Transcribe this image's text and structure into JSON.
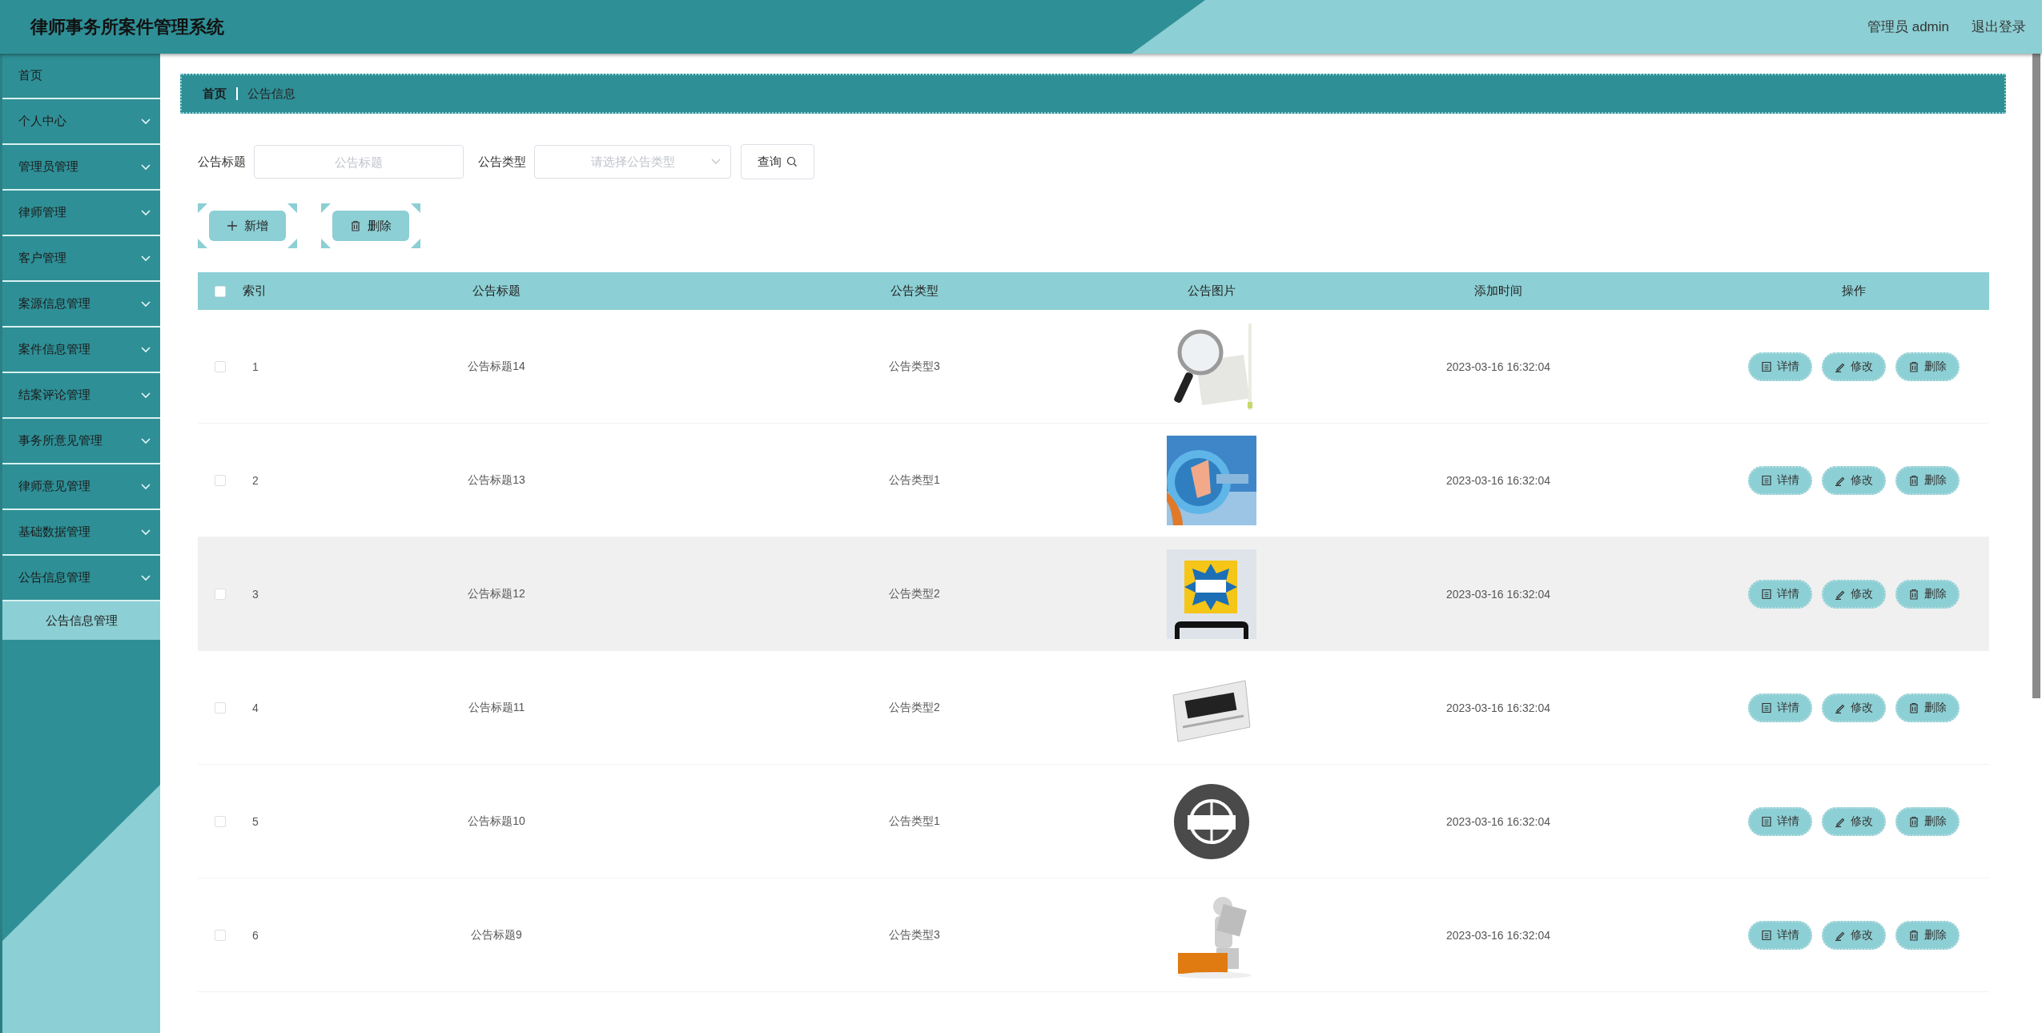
{
  "header": {
    "title": "律师事务所案件管理系统",
    "user": "管理员 admin",
    "logout": "退出登录"
  },
  "sidebar": {
    "items": [
      {
        "label": "首页",
        "kind": "link"
      },
      {
        "label": "个人中心",
        "kind": "menu"
      },
      {
        "label": "管理员管理",
        "kind": "menu"
      },
      {
        "label": "律师管理",
        "kind": "menu"
      },
      {
        "label": "客户管理",
        "kind": "menu"
      },
      {
        "label": "案源信息管理",
        "kind": "menu"
      },
      {
        "label": "案件信息管理",
        "kind": "menu"
      },
      {
        "label": "结案评论管理",
        "kind": "menu"
      },
      {
        "label": "事务所意见管理",
        "kind": "menu"
      },
      {
        "label": "律师意见管理",
        "kind": "menu"
      },
      {
        "label": "基础数据管理",
        "kind": "menu"
      },
      {
        "label": "公告信息管理",
        "kind": "menu",
        "children": [
          {
            "label": "公告信息管理",
            "selected": true
          }
        ]
      }
    ]
  },
  "breadcrumb": [
    "首页",
    "公告信息"
  ],
  "search": {
    "fields": [
      {
        "label": "公告标题",
        "kind": "input",
        "placeholder": "公告标题"
      },
      {
        "label": "公告类型",
        "kind": "select",
        "placeholder": "请选择公告类型"
      }
    ],
    "button": "查询"
  },
  "actions": [
    {
      "label": "新增",
      "kind": "add"
    },
    {
      "label": "删除",
      "kind": "delete"
    }
  ],
  "table": {
    "select_all": {
      "checked": false
    },
    "columns": [
      "索引",
      "公告标题",
      "公告类型",
      "公告图片",
      "添加时间",
      "操作"
    ],
    "rows": [
      {
        "index": "1",
        "title": "公告标题14",
        "type": "公告类型3",
        "time": "2023-03-16 16:32:04",
        "checked": false,
        "hovered": false,
        "buttons": [
          {
            "label": "详情",
            "kind": "detail"
          },
          {
            "label": "修改",
            "kind": "edit"
          },
          {
            "label": "删除",
            "kind": "delete"
          }
        ]
      },
      {
        "index": "2",
        "title": "公告标题13",
        "type": "公告类型1",
        "time": "2023-03-16 16:32:04",
        "checked": false,
        "hovered": false,
        "buttons": [
          {
            "label": "详情",
            "kind": "detail"
          },
          {
            "label": "修改",
            "kind": "edit"
          },
          {
            "label": "删除",
            "kind": "delete"
          }
        ]
      },
      {
        "index": "3",
        "title": "公告标题12",
        "type": "公告类型2",
        "time": "2023-03-16 16:32:04",
        "checked": false,
        "hovered": true,
        "buttons": [
          {
            "label": "详情",
            "kind": "detail"
          },
          {
            "label": "修改",
            "kind": "edit"
          },
          {
            "label": "删除",
            "kind": "delete"
          }
        ]
      },
      {
        "index": "4",
        "title": "公告标题11",
        "type": "公告类型2",
        "time": "2023-03-16 16:32:04",
        "checked": false,
        "hovered": false,
        "buttons": [
          {
            "label": "详情",
            "kind": "detail"
          },
          {
            "label": "修改",
            "kind": "edit"
          },
          {
            "label": "删除",
            "kind": "delete"
          }
        ]
      },
      {
        "index": "5",
        "title": "公告标题10",
        "type": "公告类型1",
        "time": "2023-03-16 16:32:04",
        "checked": false,
        "hovered": false,
        "buttons": [
          {
            "label": "详情",
            "kind": "detail"
          },
          {
            "label": "修改",
            "kind": "edit"
          },
          {
            "label": "删除",
            "kind": "delete"
          }
        ]
      },
      {
        "index": "6",
        "title": "公告标题9",
        "type": "公告类型3",
        "time": "2023-03-16 16:32:04",
        "checked": false,
        "hovered": false,
        "buttons": [
          {
            "label": "详情",
            "kind": "detail"
          },
          {
            "label": "修改",
            "kind": "edit"
          },
          {
            "label": "删除",
            "kind": "delete"
          }
        ]
      }
    ]
  }
}
